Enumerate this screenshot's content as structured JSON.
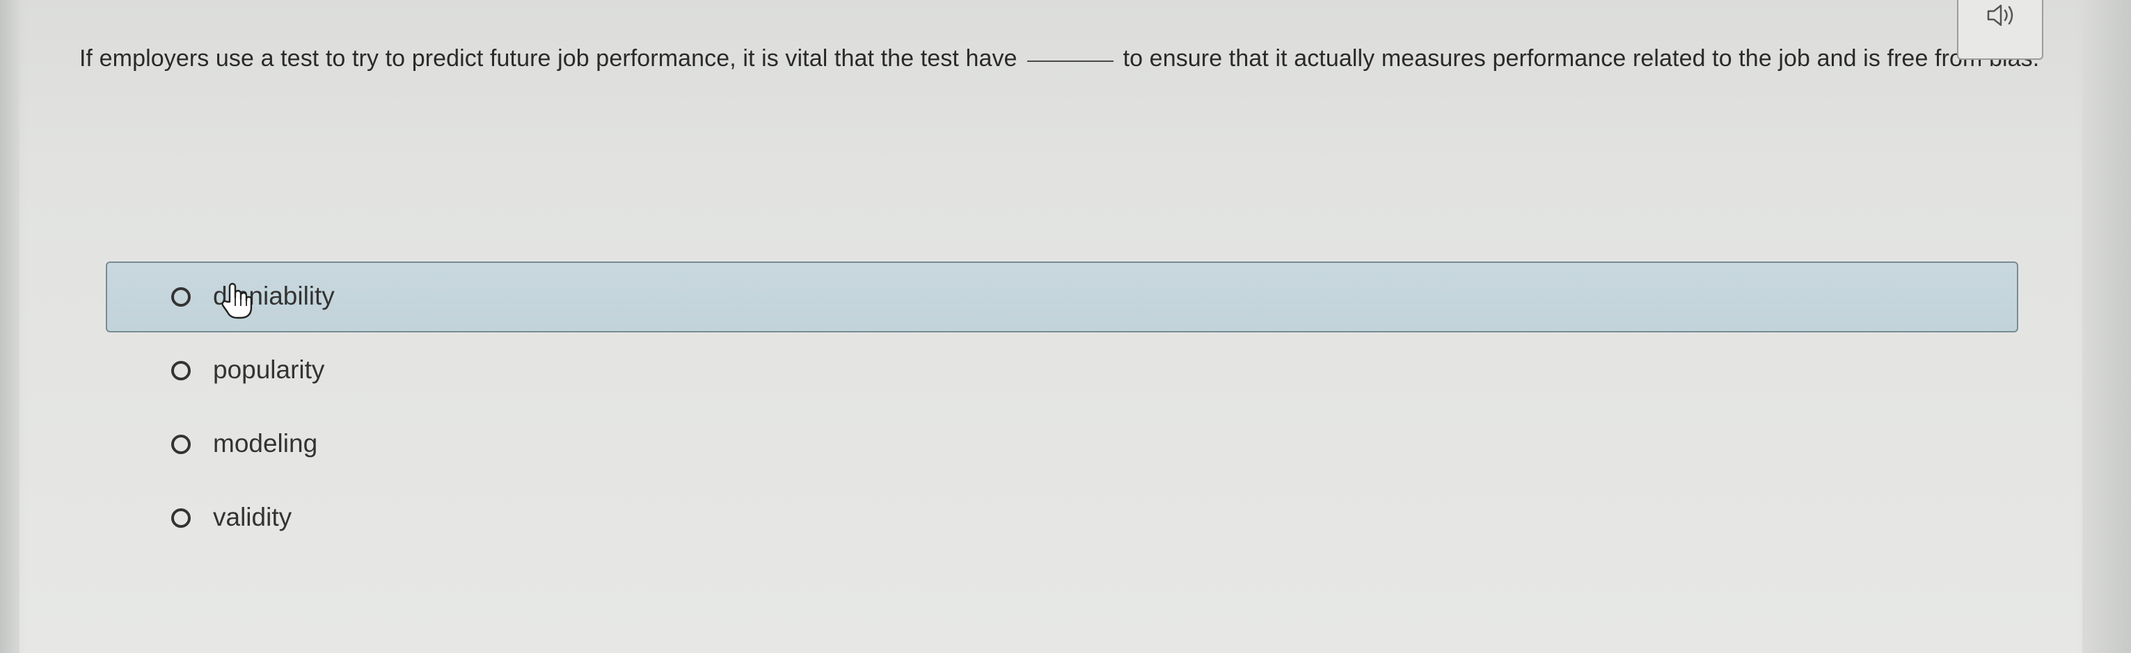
{
  "question": {
    "part1": "If employers use a test to try to predict future job performance, it is vital that the test have",
    "part2": "to ensure that it actually measures performance related to the job and is free from bias."
  },
  "audio": {
    "icon": "speaker-icon"
  },
  "options": [
    {
      "label": "dmniability",
      "hovered": true
    },
    {
      "label": "popularity",
      "hovered": false
    },
    {
      "label": "modeling",
      "hovered": false
    },
    {
      "label": "validity",
      "hovered": false
    }
  ],
  "colors": {
    "hover_bg": "#c5d6dc",
    "hover_border": "#7a8c94",
    "text": "#2b2b2b",
    "background": "#e4e5e3"
  }
}
